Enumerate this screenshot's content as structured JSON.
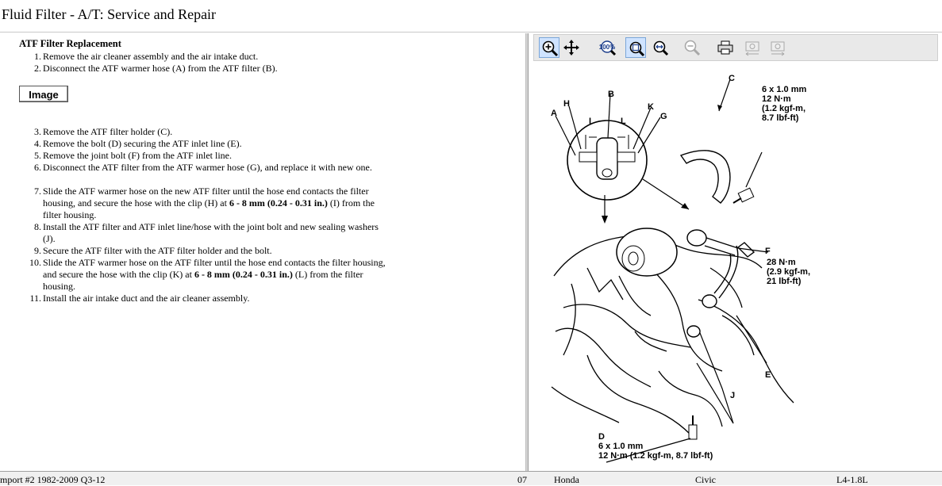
{
  "window": {
    "title": "Fluid Filter - A/T:  Service and Repair"
  },
  "procedure": {
    "title": "ATF Filter Replacement",
    "steps_a": [
      {
        "num": "1.",
        "text": "Remove the air cleaner assembly and the air intake duct."
      },
      {
        "num": "2.",
        "text": "Disconnect the ATF warmer hose (A) from the ATF filter (B)."
      }
    ],
    "image_button": "Image",
    "steps_b": [
      {
        "num": "3.",
        "text": "Remove the ATF filter holder (C)."
      },
      {
        "num": "4.",
        "text": "Remove the bolt (D) securing the ATF inlet line (E)."
      },
      {
        "num": "5.",
        "text": "Remove the joint bolt (F) from the ATF inlet line."
      },
      {
        "num": "6.",
        "text": "Disconnect the ATF filter from the ATF warmer hose (G), and replace it with new one."
      },
      {
        "num": "7.",
        "text": "Slide the ATF warmer hose on the new ATF filter until the hose end contacts the filter housing, and secure the hose with the clip (H) at",
        "bold": "6 - 8 mm (0.24 - 0.31 in.)",
        "tail": "(I) from the filter housing."
      },
      {
        "num": "8.",
        "text": "Install the ATF filter and ATF inlet line/hose with the joint bolt and new sealing washers (J)."
      },
      {
        "num": "9.",
        "text": "Secure the ATF filter with the ATF filter holder and the bolt."
      },
      {
        "num": "10.",
        "text": "Slide the ATF warmer hose on the ATF filter until the hose end contacts the filter housing, and secure the hose with the clip (K) at",
        "bold": "6 - 8 mm (0.24 - 0.31 in.)",
        "tail": "(L) from the filter housing."
      },
      {
        "num": "11.",
        "text": "Install the air intake duct and the air cleaner assembly."
      }
    ]
  },
  "toolbar": {
    "buttons": [
      {
        "name": "zoom-in-icon",
        "active": true
      },
      {
        "name": "pan-icon",
        "active": false
      },
      {
        "name": "actual-size-100-icon",
        "label": "100%",
        "active": false
      },
      {
        "name": "fit-window-icon",
        "active": true
      },
      {
        "name": "fit-width-icon",
        "active": false
      },
      {
        "name": "zoom-out-icon",
        "active": false,
        "disabled": true
      },
      {
        "name": "print-icon",
        "active": false
      },
      {
        "name": "previous-image-icon",
        "active": false,
        "disabled": true
      },
      {
        "name": "next-image-icon",
        "active": false,
        "disabled": true
      }
    ]
  },
  "diagram": {
    "labels": {
      "A": "A",
      "B": "B",
      "C": "C",
      "D": "D",
      "E": "E",
      "F": "F",
      "G": "G",
      "H": "H",
      "I": "I",
      "J": "J",
      "K": "K",
      "L": "L"
    },
    "spec_c": [
      "6 x 1.0 mm",
      "12 N·m",
      "(1.2 kgf-m,",
      "8.7 lbf-ft)"
    ],
    "spec_f": [
      "28 N·m",
      "(2.9 kgf-m,",
      "21 lbf-ft)"
    ],
    "spec_d": [
      "6 x 1.0 mm",
      "12 N·m (1.2 kgf-m, 8.7 lbf-ft)"
    ]
  },
  "status": {
    "source": "mport #2 1982-2009 Q3-12",
    "year": "07",
    "make": "Honda",
    "model": "Civic",
    "engine": "L4-1.8L"
  }
}
